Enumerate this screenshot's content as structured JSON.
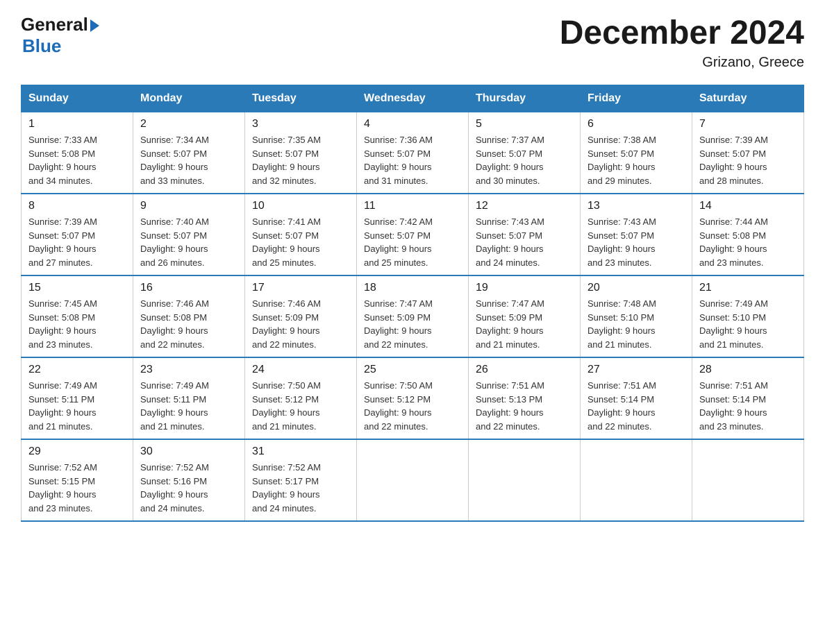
{
  "logo": {
    "general": "General",
    "blue": "Blue",
    "arrow": "▶"
  },
  "title": "December 2024",
  "location": "Grizano, Greece",
  "days_of_week": [
    "Sunday",
    "Monday",
    "Tuesday",
    "Wednesday",
    "Thursday",
    "Friday",
    "Saturday"
  ],
  "weeks": [
    [
      {
        "day": "1",
        "sunrise": "7:33 AM",
        "sunset": "5:08 PM",
        "daylight": "9 hours and 34 minutes."
      },
      {
        "day": "2",
        "sunrise": "7:34 AM",
        "sunset": "5:07 PM",
        "daylight": "9 hours and 33 minutes."
      },
      {
        "day": "3",
        "sunrise": "7:35 AM",
        "sunset": "5:07 PM",
        "daylight": "9 hours and 32 minutes."
      },
      {
        "day": "4",
        "sunrise": "7:36 AM",
        "sunset": "5:07 PM",
        "daylight": "9 hours and 31 minutes."
      },
      {
        "day": "5",
        "sunrise": "7:37 AM",
        "sunset": "5:07 PM",
        "daylight": "9 hours and 30 minutes."
      },
      {
        "day": "6",
        "sunrise": "7:38 AM",
        "sunset": "5:07 PM",
        "daylight": "9 hours and 29 minutes."
      },
      {
        "day": "7",
        "sunrise": "7:39 AM",
        "sunset": "5:07 PM",
        "daylight": "9 hours and 28 minutes."
      }
    ],
    [
      {
        "day": "8",
        "sunrise": "7:39 AM",
        "sunset": "5:07 PM",
        "daylight": "9 hours and 27 minutes."
      },
      {
        "day": "9",
        "sunrise": "7:40 AM",
        "sunset": "5:07 PM",
        "daylight": "9 hours and 26 minutes."
      },
      {
        "day": "10",
        "sunrise": "7:41 AM",
        "sunset": "5:07 PM",
        "daylight": "9 hours and 25 minutes."
      },
      {
        "day": "11",
        "sunrise": "7:42 AM",
        "sunset": "5:07 PM",
        "daylight": "9 hours and 25 minutes."
      },
      {
        "day": "12",
        "sunrise": "7:43 AM",
        "sunset": "5:07 PM",
        "daylight": "9 hours and 24 minutes."
      },
      {
        "day": "13",
        "sunrise": "7:43 AM",
        "sunset": "5:07 PM",
        "daylight": "9 hours and 23 minutes."
      },
      {
        "day": "14",
        "sunrise": "7:44 AM",
        "sunset": "5:08 PM",
        "daylight": "9 hours and 23 minutes."
      }
    ],
    [
      {
        "day": "15",
        "sunrise": "7:45 AM",
        "sunset": "5:08 PM",
        "daylight": "9 hours and 23 minutes."
      },
      {
        "day": "16",
        "sunrise": "7:46 AM",
        "sunset": "5:08 PM",
        "daylight": "9 hours and 22 minutes."
      },
      {
        "day": "17",
        "sunrise": "7:46 AM",
        "sunset": "5:09 PM",
        "daylight": "9 hours and 22 minutes."
      },
      {
        "day": "18",
        "sunrise": "7:47 AM",
        "sunset": "5:09 PM",
        "daylight": "9 hours and 22 minutes."
      },
      {
        "day": "19",
        "sunrise": "7:47 AM",
        "sunset": "5:09 PM",
        "daylight": "9 hours and 21 minutes."
      },
      {
        "day": "20",
        "sunrise": "7:48 AM",
        "sunset": "5:10 PM",
        "daylight": "9 hours and 21 minutes."
      },
      {
        "day": "21",
        "sunrise": "7:49 AM",
        "sunset": "5:10 PM",
        "daylight": "9 hours and 21 minutes."
      }
    ],
    [
      {
        "day": "22",
        "sunrise": "7:49 AM",
        "sunset": "5:11 PM",
        "daylight": "9 hours and 21 minutes."
      },
      {
        "day": "23",
        "sunrise": "7:49 AM",
        "sunset": "5:11 PM",
        "daylight": "9 hours and 21 minutes."
      },
      {
        "day": "24",
        "sunrise": "7:50 AM",
        "sunset": "5:12 PM",
        "daylight": "9 hours and 21 minutes."
      },
      {
        "day": "25",
        "sunrise": "7:50 AM",
        "sunset": "5:12 PM",
        "daylight": "9 hours and 22 minutes."
      },
      {
        "day": "26",
        "sunrise": "7:51 AM",
        "sunset": "5:13 PM",
        "daylight": "9 hours and 22 minutes."
      },
      {
        "day": "27",
        "sunrise": "7:51 AM",
        "sunset": "5:14 PM",
        "daylight": "9 hours and 22 minutes."
      },
      {
        "day": "28",
        "sunrise": "7:51 AM",
        "sunset": "5:14 PM",
        "daylight": "9 hours and 23 minutes."
      }
    ],
    [
      {
        "day": "29",
        "sunrise": "7:52 AM",
        "sunset": "5:15 PM",
        "daylight": "9 hours and 23 minutes."
      },
      {
        "day": "30",
        "sunrise": "7:52 AM",
        "sunset": "5:16 PM",
        "daylight": "9 hours and 24 minutes."
      },
      {
        "day": "31",
        "sunrise": "7:52 AM",
        "sunset": "5:17 PM",
        "daylight": "9 hours and 24 minutes."
      },
      null,
      null,
      null,
      null
    ]
  ],
  "labels": {
    "sunrise": "Sunrise:",
    "sunset": "Sunset:",
    "daylight": "Daylight:"
  }
}
